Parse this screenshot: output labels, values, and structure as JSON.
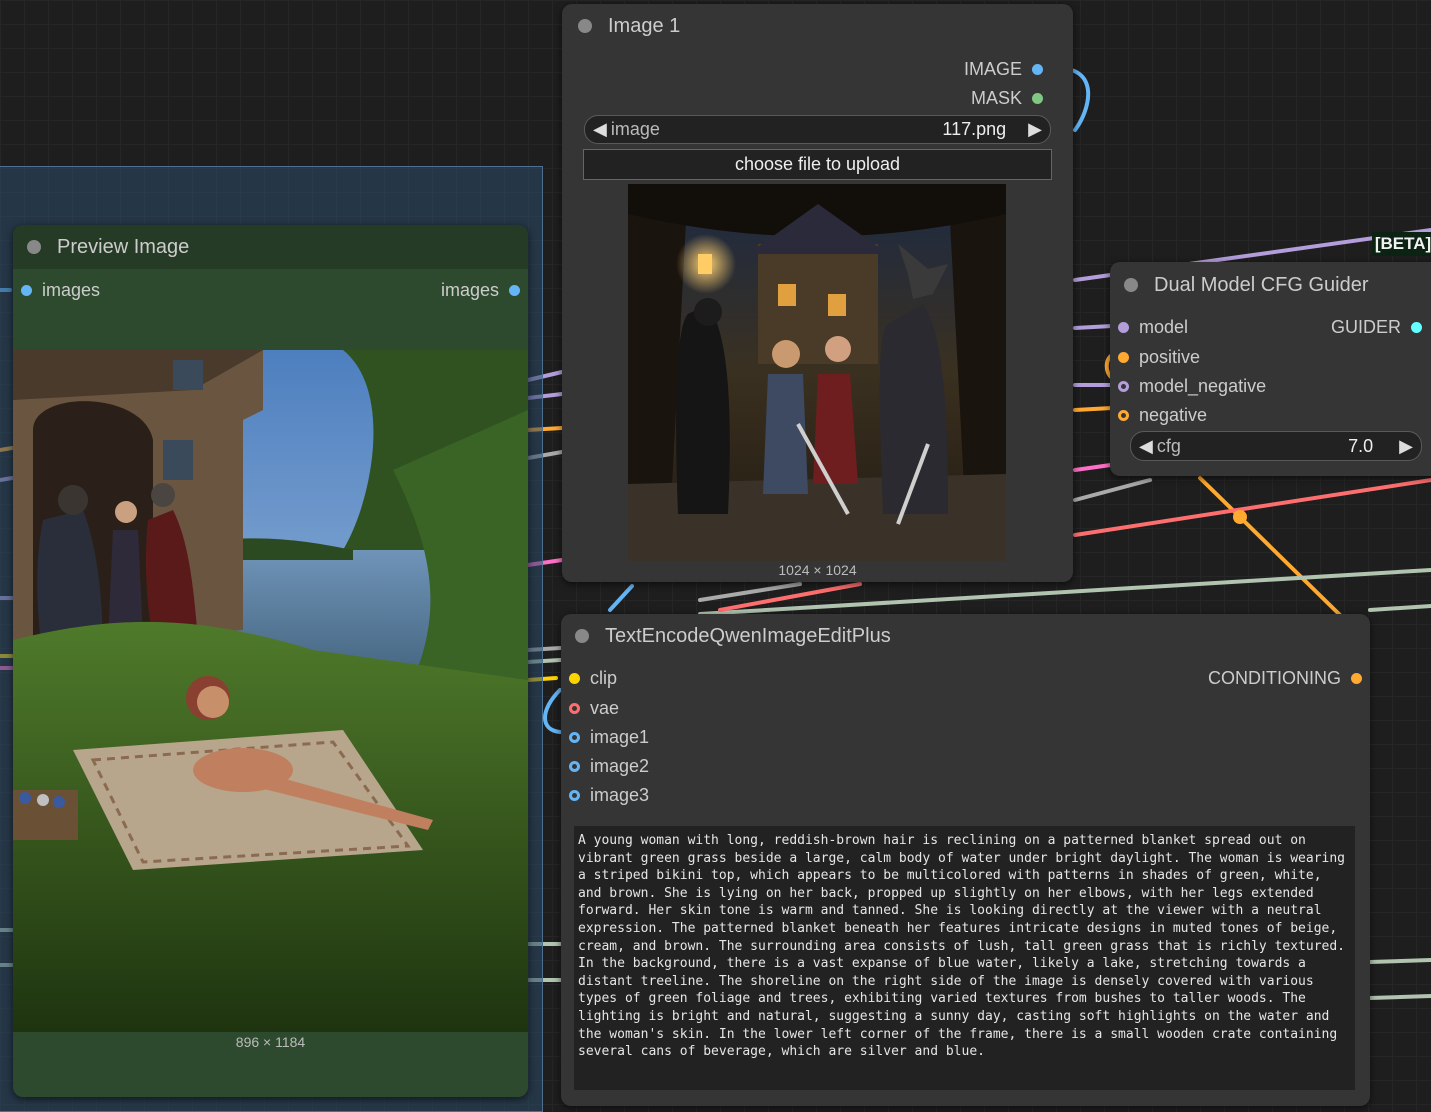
{
  "colors": {
    "image_port": "#64b5f6",
    "mask_port": "#81c784",
    "model_port": "#b39ddb",
    "conditioning_port": "#ffa931",
    "clip_port": "#ffd500",
    "vae_port": "#ff6e6e",
    "guider_port": "#66ffff",
    "preview_node_bg": "#2e4a2e",
    "group_bg": "#2c4a68"
  },
  "load_image_node": {
    "title": "Image 1",
    "outputs": [
      {
        "label": "IMAGE",
        "icon": "image-port-dot"
      },
      {
        "label": "MASK",
        "icon": "mask-port-dot"
      }
    ],
    "image_widget": {
      "label": "image",
      "value": "117.png"
    },
    "upload_button": "choose file to upload",
    "image_size": "1024 × 1024"
  },
  "preview_image_node": {
    "title": "Preview Image",
    "input_label": "images",
    "output_label": "images",
    "image_size": "896 × 1184"
  },
  "dual_cfg_node": {
    "title": "Dual Model CFG Guider",
    "inputs": [
      "model",
      "positive",
      "model_negative",
      "negative"
    ],
    "output": "GUIDER",
    "cfg_widget": {
      "label": "cfg",
      "value": "7.0"
    },
    "badge": "[BETA]"
  },
  "text_encode_node": {
    "title": "TextEncodeQwenImageEditPlus",
    "inputs": [
      "clip",
      "vae",
      "image1",
      "image2",
      "image3"
    ],
    "output": "CONDITIONING",
    "prompt": "A young woman with long, reddish-brown hair is reclining on a patterned blanket spread out on vibrant green grass beside a large, calm body of water under bright daylight. The woman is wearing a striped bikini top, which appears to be multicolored with patterns in shades of green, white, and brown. She is lying on her back, propped up slightly on her elbows, with her legs extended forward. Her skin tone is warm and tanned. She is looking directly at the viewer with a neutral expression. The patterned blanket beneath her features intricate designs in muted tones of beige, cream, and brown. The surrounding area consists of lush, tall green grass that is richly textured. In the background, there is a vast expanse of blue water, likely a lake, stretching towards a distant treeline. The shoreline on the right side of the image is densely covered with various types of green foliage and trees, exhibiting varied textures from bushes to taller woods. The lighting is bright and natural, suggesting a sunny day, casting soft highlights on the water and the woman's skin. In the lower left corner of the frame, there is a small wooden crate containing several cans of beverage, which are silver and blue."
  }
}
